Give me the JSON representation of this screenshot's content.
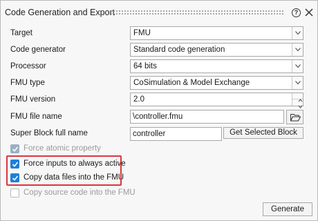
{
  "dialog": {
    "title": "Code Generation and Export",
    "help_icon": "help-circle-icon",
    "close_icon": "close-icon"
  },
  "fields": {
    "target": {
      "label": "Target",
      "value": "FMU"
    },
    "code_generator": {
      "label": "Code generator",
      "value": "Standard code generation"
    },
    "processor": {
      "label": "Processor",
      "value": "64 bits"
    },
    "fmu_type": {
      "label": "FMU type",
      "value": "CoSimulation & Model Exchange"
    },
    "fmu_version": {
      "label": "FMU version",
      "value": "2.0"
    },
    "fmu_file_name": {
      "label": "FMU file name",
      "value": "\\controller.fmu",
      "browse_icon": "folder-open-icon"
    },
    "super_block": {
      "label": "Super Block full name",
      "value": "controller",
      "button_label": "Get Selected Block"
    }
  },
  "options": [
    {
      "label": "Force atomic property",
      "checked": true,
      "enabled": false
    },
    {
      "label": "Force inputs to always active",
      "checked": true,
      "enabled": true
    },
    {
      "label": "Copy data files into the FMU",
      "checked": true,
      "enabled": true
    },
    {
      "label": "Copy source code into the FMU",
      "checked": false,
      "enabled": false
    }
  ],
  "colors": {
    "checkbox_active": "#1e7fd8",
    "checkbox_disabled": "#9ab0c4",
    "highlight_border": "#d9363e"
  },
  "footer": {
    "generate_label": "Generate"
  }
}
